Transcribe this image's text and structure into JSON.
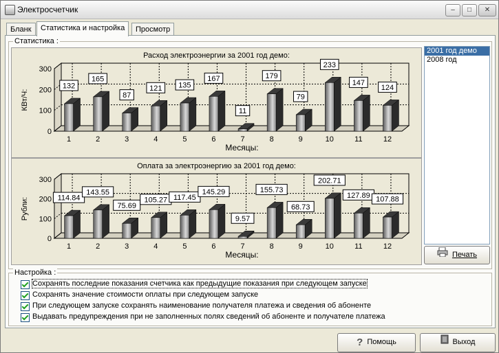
{
  "window": {
    "title": "Электросчетчик",
    "icon": "meter-icon"
  },
  "tabs": [
    "Бланк",
    "Статистика и настройка",
    "Просмотр"
  ],
  "stats_group_label": "Статистика :",
  "settings_group_label": "Настройка :",
  "years": {
    "items": [
      "2001  год демо",
      "2008 год"
    ],
    "selected_index": 0
  },
  "print_button": "Печать",
  "help_button": "Помощь",
  "exit_button": "Выход",
  "settings": [
    {
      "label": "Сохранять последние показания счетчика как предыдущие показания при следующем запуске",
      "checked": true
    },
    {
      "label": "Сохранять значение стоимости оплаты при следующем запуске",
      "checked": true
    },
    {
      "label": "При следующем запуске сохранять наименование получателя платежа и сведения об абоненте",
      "checked": true
    },
    {
      "label": "Выдавать предупреждения при не заполненных полях сведений об абоненте и получателе платежа",
      "checked": true
    }
  ],
  "chart_data": [
    {
      "type": "bar",
      "title": "Расход электроэнергии за  2001  год демо:",
      "xlabel": "Месяцы:",
      "ylabel": "КВт/Ч:",
      "categories": [
        "1",
        "2",
        "3",
        "4",
        "5",
        "6",
        "7",
        "8",
        "9",
        "10",
        "11",
        "12"
      ],
      "values": [
        132,
        165,
        87,
        121,
        135,
        167,
        11,
        179,
        79,
        233,
        147,
        124
      ],
      "labels": [
        "132",
        "165",
        "87",
        "121",
        "135",
        "167",
        "11",
        "179",
        "79",
        "233",
        "147",
        "124"
      ],
      "ylim": [
        0,
        300
      ],
      "yticks": [
        0,
        100,
        200,
        300
      ],
      "grid": true
    },
    {
      "type": "bar",
      "title": "Оплата за электроэнергию за  2001  год демо:",
      "xlabel": "Месяцы:",
      "ylabel": "Рубли:",
      "categories": [
        "1",
        "2",
        "3",
        "4",
        "5",
        "6",
        "7",
        "8",
        "9",
        "10",
        "11",
        "12"
      ],
      "values": [
        114.84,
        143.55,
        75.69,
        105.27,
        117.45,
        145.29,
        9.57,
        155.73,
        68.73,
        202.71,
        127.89,
        107.88
      ],
      "labels": [
        "114.84",
        "143.55",
        "75.69",
        "105.27",
        "117.45",
        "145.29",
        "9.57",
        "155.73",
        "68.73",
        "202.71",
        "127.89",
        "107.88"
      ],
      "ylim": [
        0,
        300
      ],
      "yticks": [
        0,
        100,
        200,
        300
      ],
      "grid": true
    }
  ]
}
